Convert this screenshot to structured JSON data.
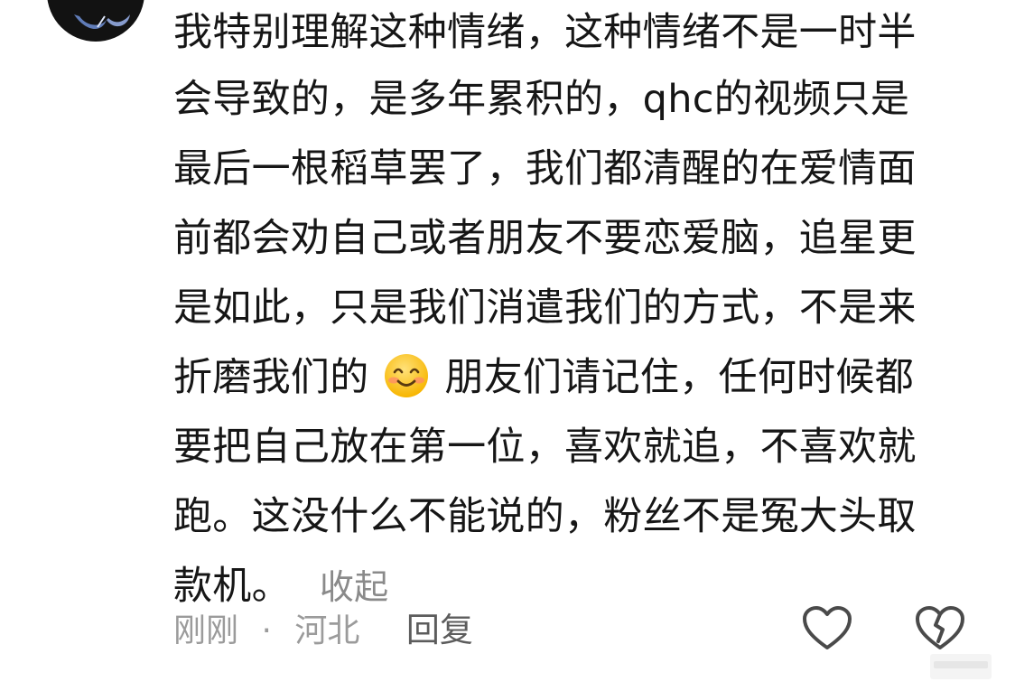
{
  "comment": {
    "lines": [
      "我特别理解这种情绪，这种情绪不是一时半",
      "会导致的，是多年累积的，qhc的视频只是",
      "最后一根稻草罢了，我们都清醒的在爱情面",
      "前都会劝自己或者朋友不要恋爱脑，追星更",
      "是如此，只是我们消遣我们的方式，不是来"
    ],
    "line6_before_emoji": "折磨我们的",
    "emoji": "smiling-face-emoji",
    "line6_after_emoji": "朋友们请记住，任何时候都",
    "lines_after": [
      "要把自己放在第一位，喜欢就追，不喜欢就",
      "跑。这没什么不能说的，粉丝不是冤大头取"
    ],
    "last_line": "款机。",
    "collapse_label": "收起"
  },
  "meta": {
    "time": "刚刚",
    "separator": "·",
    "location": "河北",
    "reply_label": "回复"
  },
  "icons": {
    "like": "heart-outline-icon",
    "dislike": "broken-heart-icon"
  },
  "colors": {
    "text": "#161616",
    "muted": "#9b9b9b",
    "icon": "#4a4a4a"
  }
}
